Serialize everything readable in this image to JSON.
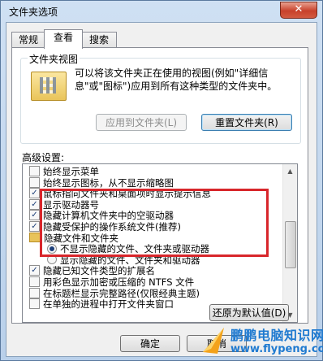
{
  "window": {
    "title": "文件夹选项",
    "close_label": "✕"
  },
  "tabs": [
    {
      "label": "常规",
      "active": false
    },
    {
      "label": "查看",
      "active": true
    },
    {
      "label": "搜索",
      "active": false
    }
  ],
  "folder_views": {
    "group_label": "文件夹视图",
    "description": "可以将该文件夹正在使用的视图(例如\"详细信息\"或\"图标\")应用到所有这种类型的文件夹中。",
    "apply_button": "应用到文件夹(L)",
    "apply_enabled": false,
    "reset_button": "重置文件夹(R)"
  },
  "advanced": {
    "label": "高级设置:",
    "items": [
      {
        "type": "checkbox",
        "checked": false,
        "label": "始终显示菜单",
        "indent": 0
      },
      {
        "type": "checkbox",
        "checked": false,
        "label": "始终显示图标，从不显示缩略图",
        "indent": 0
      },
      {
        "type": "checkbox",
        "checked": true,
        "label": "鼠标指向文件夹和桌面项时显示提示信息",
        "indent": 0
      },
      {
        "type": "checkbox",
        "checked": true,
        "label": "显示驱动器号",
        "indent": 0
      },
      {
        "type": "checkbox",
        "checked": true,
        "label": "隐藏计算机文件夹中的空驱动器",
        "indent": 0
      },
      {
        "type": "checkbox",
        "checked": true,
        "label": "隐藏受保护的操作系统文件(推荐)",
        "indent": 0
      },
      {
        "type": "folder",
        "label": "隐藏文件和文件夹",
        "indent": 0
      },
      {
        "type": "radio",
        "checked": true,
        "label": "不显示隐藏的文件、文件夹或驱动器",
        "indent": 1
      },
      {
        "type": "radio",
        "checked": false,
        "label": "显示隐藏的文件、文件夹和驱动器",
        "indent": 1
      },
      {
        "type": "checkbox",
        "checked": true,
        "label": "隐藏已知文件类型的扩展名",
        "indent": 0
      },
      {
        "type": "checkbox",
        "checked": false,
        "label": "用彩色显示加密或压缩的 NTFS 文件",
        "indent": 0
      },
      {
        "type": "checkbox",
        "checked": false,
        "label": "在标题栏显示完整路径(仅限经典主题)",
        "indent": 0
      },
      {
        "type": "checkbox",
        "checked": false,
        "label": "在单独的进程中打开文件夹窗口",
        "indent": 0
      }
    ]
  },
  "restore_button": "还原为默认值(D)",
  "ok_button": "确定",
  "cancel_button": "取消",
  "watermark": {
    "text": "鹏鹏电脑知识网",
    "url": "www.flypeng.com"
  }
}
